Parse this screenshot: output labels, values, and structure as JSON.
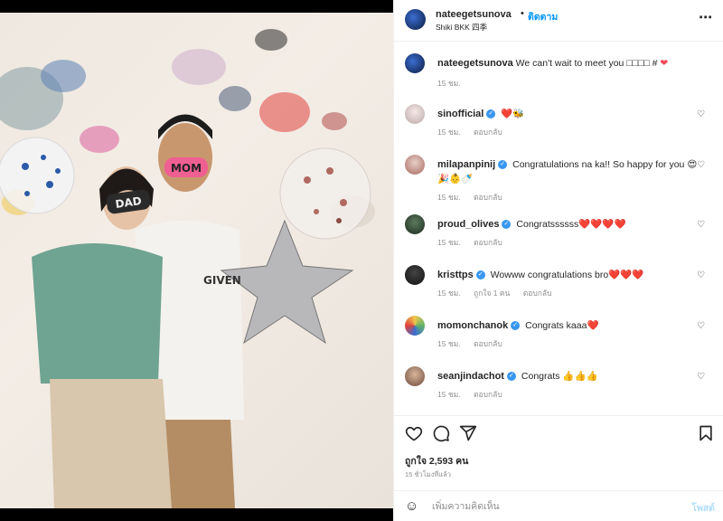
{
  "header": {
    "username": "nateegetsunova",
    "dot": "•",
    "follow_label": "ติดตาม",
    "location": "Shiki BKK 四季",
    "more_icon": "ellipsis-icon"
  },
  "caption": {
    "username": "nateegetsunova",
    "text": "We can't wait to meet you □□□□ #",
    "emoji": "❤",
    "time": "15 ชม."
  },
  "comments": [
    {
      "username": "sinofficial",
      "verified": true,
      "text": "❤️🐝",
      "time": "15 ชม.",
      "likes": "",
      "reply": "ตอบกลับ"
    },
    {
      "username": "milapanpinij",
      "verified": true,
      "text": "Congratulations na ka!! So happy for you 😍 🎉👶🍼",
      "time": "15 ชม.",
      "likes": "",
      "reply": "ตอบกลับ"
    },
    {
      "username": "proud_olives",
      "verified": true,
      "text": "Congratssssss❤️❤️❤️❤️",
      "time": "15 ชม.",
      "likes": "",
      "reply": "ตอบกลับ"
    },
    {
      "username": "kristtps",
      "verified": true,
      "text": "Wowww congratulations bro❤️❤️❤️",
      "time": "15 ชม.",
      "likes": "ถูกใจ 1 คน",
      "reply": "ตอบกลับ"
    },
    {
      "username": "momonchanok",
      "verified": true,
      "text": "Congrats kaaa❤️",
      "time": "15 ชม.",
      "likes": "",
      "reply": "ตอบกลับ"
    },
    {
      "username": "seanjindachot",
      "verified": true,
      "text": "Congrats 👍👍👍",
      "time": "15 ชม.",
      "likes": "",
      "reply": "ตอบกลับ"
    }
  ],
  "actions": {
    "likes_label": "ถูกใจ 2,593 คน",
    "posted_time": "15 ชั่วโมงที่แล้ว"
  },
  "add_comment": {
    "placeholder": "เพิ่มความคิดเห็น",
    "post_label": "โพสต์"
  },
  "photo_props": {
    "mom_sign": "MOM",
    "dad_sign": "DAD",
    "shirt_text": "GIVEN"
  },
  "colors": {
    "verified": "#3897f0",
    "link": "#0095f6",
    "heart": "#ed4956"
  }
}
